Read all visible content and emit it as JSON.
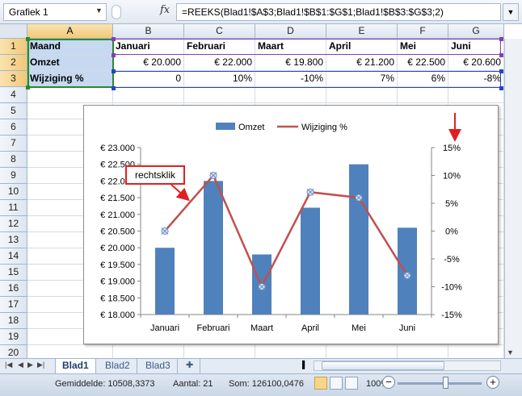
{
  "formula_bar": {
    "name_box": "Grafiek 1",
    "fx": "fx",
    "formula": "=REEKS(Blad1!$A$3;Blad1!$B$1:$G$1;Blad1!$B$3:$G$3;2)"
  },
  "columns": [
    "A",
    "B",
    "C",
    "D",
    "E",
    "F",
    "G"
  ],
  "rows": [
    "1",
    "2",
    "3",
    "4",
    "5",
    "6",
    "7",
    "8",
    "9",
    "10",
    "11",
    "12",
    "13",
    "14",
    "15",
    "16",
    "17",
    "18",
    "19",
    "20"
  ],
  "table": {
    "header": [
      "Maand",
      "Januari",
      "Februari",
      "Maart",
      "April",
      "Mei",
      "Juni"
    ],
    "omzet": [
      "Omzet",
      "€ 20.000",
      "€ 22.000",
      "€ 19.800",
      "€ 21.200",
      "€ 22.500",
      "€ 20.600"
    ],
    "wijziging": [
      "Wijziging %",
      "0",
      "10%",
      "-10%",
      "7%",
      "6%",
      "-8%"
    ]
  },
  "callout": "rechtsklik",
  "chart_data": {
    "type": "bar",
    "categories": [
      "Januari",
      "Februari",
      "Maart",
      "April",
      "Mei",
      "Juni"
    ],
    "series": [
      {
        "name": "Omzet",
        "type": "bar",
        "axis": "left",
        "values": [
          20000,
          22000,
          19800,
          21200,
          22500,
          20600
        ],
        "color": "#4f81bd"
      },
      {
        "name": "Wijziging %",
        "type": "line",
        "axis": "right",
        "values": [
          0,
          10,
          -10,
          7,
          6,
          -8
        ],
        "color": "#c0504d"
      }
    ],
    "ylim": [
      18000,
      23000
    ],
    "y_ticks": [
      "€ 18.000",
      "€ 18.500",
      "€ 19.000",
      "€ 19.500",
      "€ 20.000",
      "€ 20.500",
      "€ 21.000",
      "€ 21.500",
      "€ 22.000",
      "€ 22.500",
      "€ 23.000"
    ],
    "y2lim": [
      -15,
      15
    ],
    "y2_ticks": [
      "-15%",
      "-10%",
      "-5%",
      "0%",
      "5%",
      "10%",
      "15%"
    ],
    "legend": "top",
    "grid": false
  },
  "sheets": [
    "Blad1",
    "Blad2",
    "Blad3"
  ],
  "status": {
    "average": "Gemiddelde: 10508,3373",
    "count": "Aantal: 21",
    "sum": "Som: 126100,0476",
    "zoom": "100%"
  },
  "colors": {
    "bar": "#4f81bd",
    "line": "#c0504d",
    "highlight": "#c6d9f1",
    "arrow": "#e02020"
  }
}
